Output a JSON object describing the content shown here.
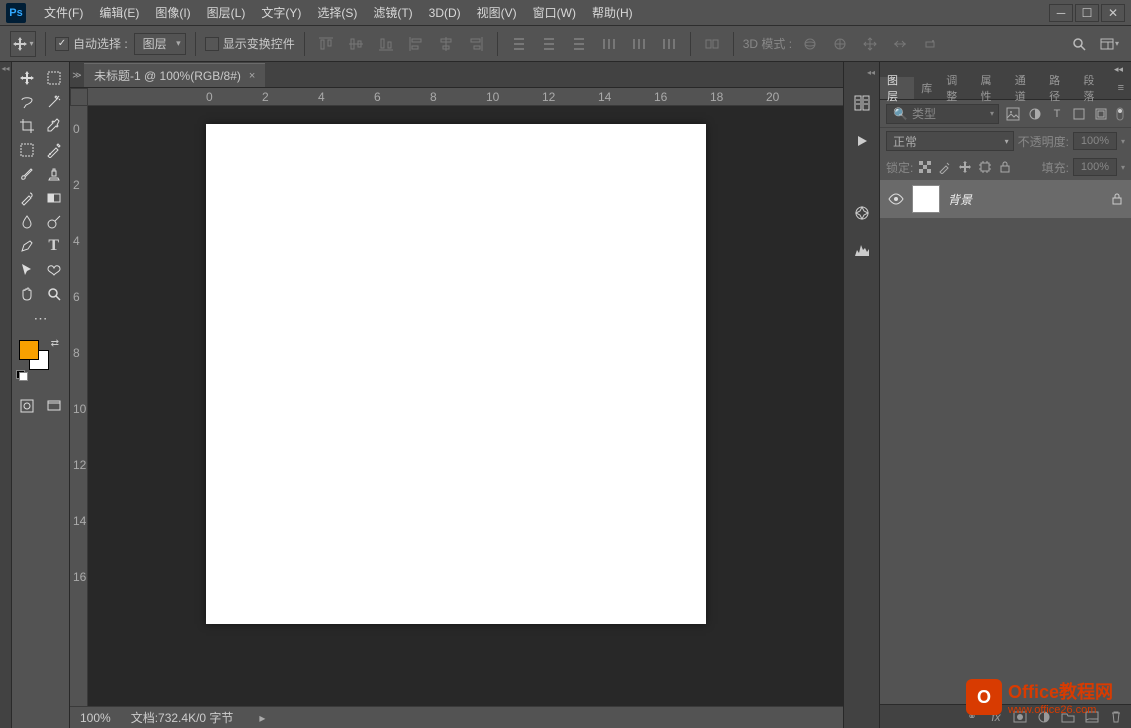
{
  "app": {
    "logo": "Ps"
  },
  "menu": {
    "file": "文件(F)",
    "edit": "编辑(E)",
    "image": "图像(I)",
    "layer": "图层(L)",
    "type": "文字(Y)",
    "select": "选择(S)",
    "filter": "滤镜(T)",
    "threed": "3D(D)",
    "view": "视图(V)",
    "window": "窗口(W)",
    "help": "帮助(H)"
  },
  "options": {
    "auto_select_label": "自动选择 :",
    "auto_select_checked": "✓",
    "auto_select_target": "图层",
    "show_transform_label": "显示变换控件",
    "threed_mode_label": "3D 模式 :"
  },
  "document": {
    "tab_title": "未标题-1 @ 100%(RGB/8#)",
    "zoom": "100%",
    "status": "文档:732.4K/0 字节"
  },
  "ruler": {
    "h": [
      "0",
      "2",
      "4",
      "6",
      "8",
      "10",
      "12",
      "14",
      "16",
      "18",
      "20"
    ],
    "v": [
      "0",
      "2",
      "4",
      "6",
      "8",
      "10",
      "12",
      "14",
      "16"
    ]
  },
  "panels": {
    "tabs": {
      "layers": "图层",
      "library": "库",
      "adjust": "调整",
      "properties": "属性",
      "channels": "通道",
      "paths": "路径",
      "styles": "段落"
    },
    "filter_placeholder": "类型",
    "blend_mode": "正常",
    "opacity_label": "不透明度:",
    "opacity_value": "100%",
    "lock_label": "锁定:",
    "fill_label": "填充:",
    "fill_value": "100%",
    "layer": {
      "name": "背景"
    }
  },
  "colors": {
    "foreground": "#f7a000",
    "background": "#ffffff"
  },
  "watermark": {
    "badge": "O",
    "title": "Office教程网",
    "url": "www.office26.com"
  }
}
